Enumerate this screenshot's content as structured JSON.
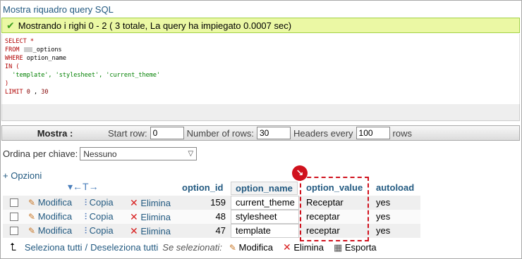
{
  "top_link": "Mostra riquadro query SQL",
  "success_msg": "Mostrando i righi 0 - 2 ( 3 totale, La query ha impiegato 0.0007 sec)",
  "sql": {
    "select": "SELECT",
    "star": "*",
    "from": "FROM",
    "table": "_options",
    "where": "WHERE",
    "where_col": "option_name",
    "in": "IN",
    "open_paren": "(",
    "values": "'template', 'stylesheet', 'current_theme'",
    "close_paren": ")",
    "limit": "LIMIT",
    "limit_start": "0",
    "limit_sep": ",",
    "limit_count": "30"
  },
  "nav": {
    "mostra": "Mostra :",
    "start_row_label": "Start row:",
    "start_row_value": "0",
    "num_rows_label": "Number of rows:",
    "num_rows_value": "30",
    "headers_label": "Headers every",
    "headers_value": "100",
    "rows_label": "rows"
  },
  "sort": {
    "label": "Ordina per chiave:",
    "selected": "Nessuno"
  },
  "options_link": "+ Opzioni",
  "columns": {
    "option_id": "option_id",
    "option_name": "option_name",
    "option_value": "option_value",
    "autoload": "autoload"
  },
  "actions": {
    "edit": "Modifica",
    "copy": "Copia",
    "delete": "Elimina"
  },
  "rows": [
    {
      "option_id": "159",
      "option_name": "current_theme",
      "option_value": "Receptar",
      "autoload": "yes"
    },
    {
      "option_id": "48",
      "option_name": "stylesheet",
      "option_value": "receptar",
      "autoload": "yes"
    },
    {
      "option_id": "47",
      "option_name": "template",
      "option_value": "receptar",
      "autoload": "yes"
    }
  ],
  "footer": {
    "select_all": "Seleziona tutti",
    "separator": "/",
    "deselect_all": "Deseleziona tutti",
    "with_selected": "Se selezionati:",
    "edit": "Modifica",
    "delete": "Elimina",
    "export": "Esporta"
  },
  "badge_icon": "arrow-down-right-icon",
  "colors": {
    "link": "#235a81",
    "success_bg": "#ebf8a4",
    "highlight": "#d0111d"
  }
}
